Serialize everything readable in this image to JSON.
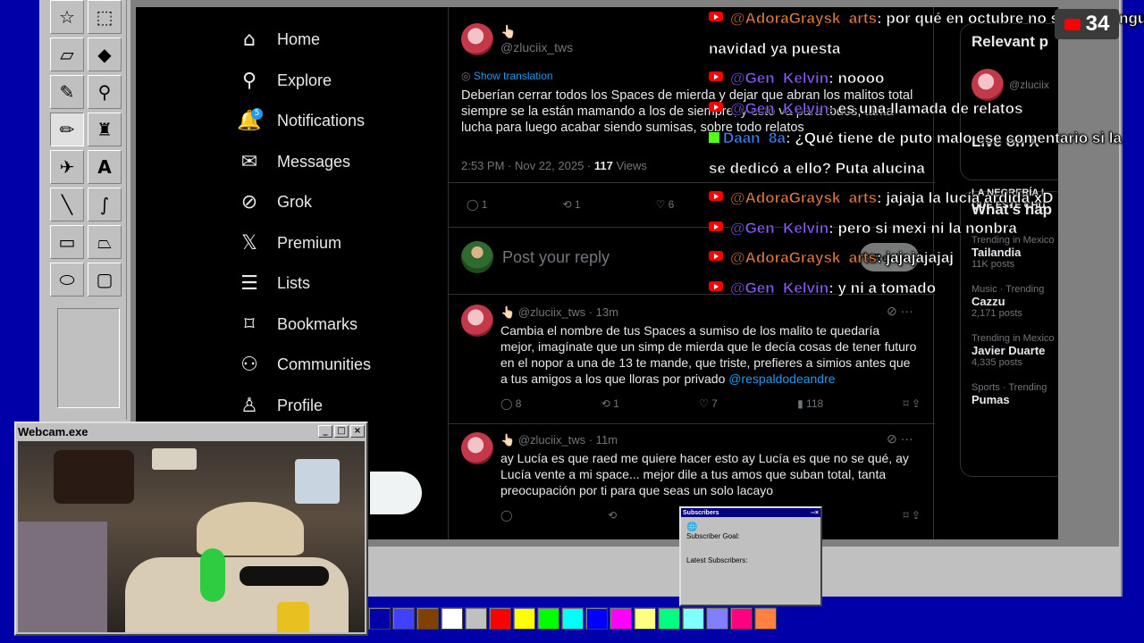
{
  "nav": {
    "items": [
      {
        "label": "Home",
        "icon": "home-icon"
      },
      {
        "label": "Explore",
        "icon": "search-icon"
      },
      {
        "label": "Notifications",
        "icon": "bell-icon",
        "badge": "5"
      },
      {
        "label": "Messages",
        "icon": "mail-icon"
      },
      {
        "label": "Grok",
        "icon": "grok-icon"
      },
      {
        "label": "Premium",
        "icon": "x-logo-icon"
      },
      {
        "label": "Lists",
        "icon": "list-icon"
      },
      {
        "label": "Bookmarks",
        "icon": "bookmark-icon"
      },
      {
        "label": "Communities",
        "icon": "people-icon"
      },
      {
        "label": "Profile",
        "icon": "person-icon"
      }
    ]
  },
  "main_post": {
    "handle": "@zluciix_tws",
    "show_translation": "Show translation",
    "text": "Deberían cerrar todos los Spaces de mierda y dejar que abran los malitos total siempre se la están mamando a los de siempre, y esto va para todos, tanta lucha para luego acabar siendo sumisas, sobre todo relatos",
    "time": "2:53 PM · Nov 22, 2025 · ",
    "views_count": "117",
    "views_label": " Views",
    "replies": "1",
    "reposts": "1",
    "likes": "6"
  },
  "reply_box": {
    "placeholder": "Post your reply",
    "button": "Reply"
  },
  "replies": [
    {
      "handle": "@zluciix_tws · 13m",
      "text": "Cambia el nombre de tus Spaces a sumiso de los malito te quedaría mejor, imagínate que un simp de mierda que le decía cosas de tener futuro en el nopor a una de 13 te mande, que triste, prefieres a simios antes que a tus amigos a los que lloras por privado ",
      "mention": "@respaldodeandre",
      "replies": "8",
      "reposts": "1",
      "likes": "7",
      "views": "118"
    },
    {
      "handle": "@zluciix_tws · 11m",
      "text": "ay Lucía es que raed me quiere hacer esto ay Lucía es que no se qué, ay Lucía vente a mi space... mejor dile a tus amos que suban total, tanta preocupación por ti para que seas un solo lacayo",
      "mention": ""
    }
  ],
  "right_col": {
    "relevant": "Relevant p",
    "relevant_handle": "@zluciix",
    "live_on_x": "Live on X",
    "live_item": "LA NEGRERÍA I QUE ESTE CHU",
    "whats_happening": "What’s hap",
    "trends": [
      {
        "meta": "Trending in Mexico",
        "name": "Tailandia",
        "posts": "11K posts"
      },
      {
        "meta": "Music · Trending",
        "name": "Cazzu",
        "posts": "2,171 posts"
      },
      {
        "meta": "Trending in Mexico",
        "name": "Javier Duarte",
        "posts": "4,335 posts"
      },
      {
        "meta": "Sports · Trending",
        "name": "Pumas",
        "posts": ""
      }
    ]
  },
  "chat": [
    {
      "user": "@AdoraGraysk_arts",
      "color": "#e07a3c",
      "msg": ": por qué en octubre no se veía ninguna",
      "yt": true
    },
    {
      "user": "",
      "color": "#ffffff",
      "msg": "navidad ya puesta",
      "yt": false
    },
    {
      "user": "@Gen_Kelvin",
      "color": "#8a5cff",
      "msg": ": noooo",
      "yt": true
    },
    {
      "user": "@Gen_Kelvin",
      "color": "#8a5cff",
      "msg": ": es una llamada de relatos",
      "yt": true
    },
    {
      "user": "Daan_8a",
      "color": "#3b82f6",
      "msg": ": ¿Qué tiene de puto malo ese comentario si la",
      "yt": false
    },
    {
      "user": "",
      "color": "#ffffff",
      "msg": "se dedicó a ello? Puta alucina",
      "yt": false
    },
    {
      "user": "@AdoraGraysk_arts",
      "color": "#e07a3c",
      "msg": ": jajaja la lucía ardida xD",
      "yt": true
    },
    {
      "user": "@Gen_Kelvin",
      "color": "#8a5cff",
      "msg": ": pero si mexi ni la nonbra",
      "yt": true
    },
    {
      "user": "@AdoraGraysk_arts",
      "color": "#e07a3c",
      "msg": ": jajajajajaj",
      "yt": true
    },
    {
      "user": "@Gen_Kelvin",
      "color": "#8a5cff",
      "msg": ": y ni a tomado",
      "yt": true
    }
  ],
  "viewers": "34",
  "webcam": {
    "title": "Webcam.exe"
  },
  "subscribers": {
    "title": "Subscribers",
    "goal": "Subscriber Goal:",
    "latest": "Latest Subscribers:"
  },
  "palette": [
    "#0000a8",
    "#4040ff",
    "#804000",
    "#ffffff",
    "#c0c0c0",
    "#ff0000",
    "#ffff00",
    "#00ff00",
    "#00ffff",
    "#0000ff",
    "#ff00ff",
    "#ffff80",
    "#00ff80",
    "#80ffff",
    "#8080ff",
    "#ff0080",
    "#ff8040"
  ]
}
